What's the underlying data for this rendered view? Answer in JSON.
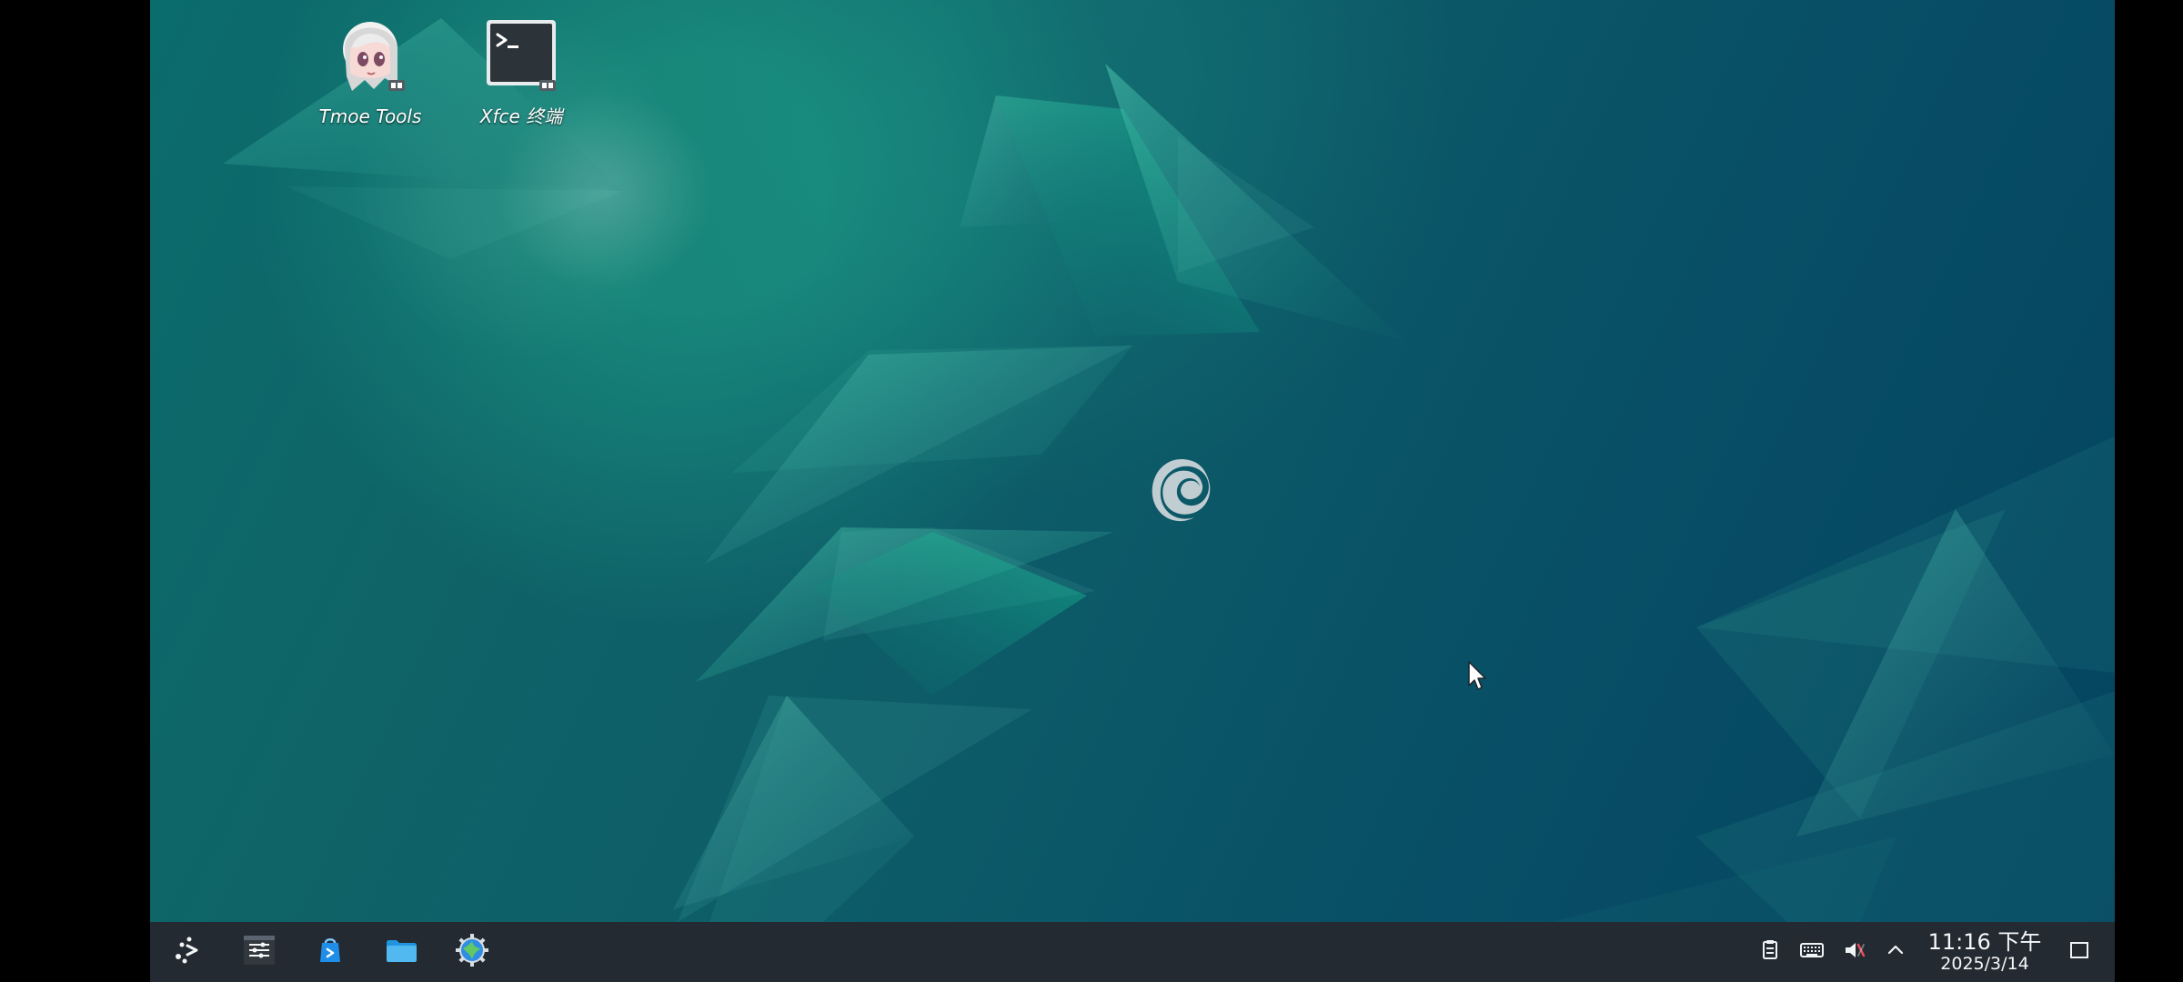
{
  "desktop": {
    "icons": [
      {
        "label": "Tmoe Tools",
        "icon": "tmoe-tools-icon"
      },
      {
        "label": "Xfce 终端",
        "icon": "terminal-icon"
      }
    ]
  },
  "taskbar": {
    "launchers": [
      {
        "name": "application-menu",
        "icon": "kde-launcher-icon"
      },
      {
        "name": "system-settings",
        "icon": "settings-slider-icon"
      },
      {
        "name": "discover",
        "icon": "software-store-icon"
      },
      {
        "name": "file-manager",
        "icon": "folder-icon"
      },
      {
        "name": "web-browser",
        "icon": "globe-gear-icon"
      }
    ],
    "tray": {
      "clipboard_icon": "clipboard-icon",
      "keyboard_icon": "keyboard-icon",
      "volume_icon": "muted-volume-icon",
      "expand_icon": "chevron-up-icon"
    },
    "clock": {
      "time": "11:16 下午",
      "date": "2025/3/14"
    },
    "show_desktop_icon": "show-desktop-icon"
  },
  "colors": {
    "taskbar": "#242a31",
    "desktop_primary": "#0f6467",
    "desktop_secondary": "#04445f",
    "accent": "#24b896"
  }
}
